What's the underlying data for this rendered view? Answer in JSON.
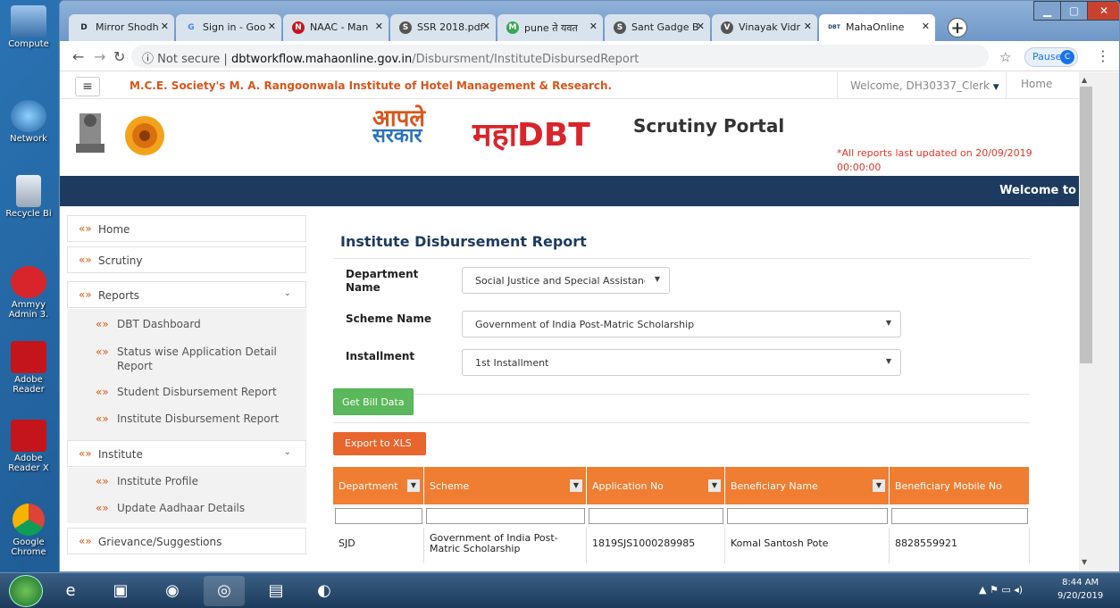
{
  "desktop": {
    "icons": [
      {
        "label": "Compute",
        "name": "computer-icon"
      },
      {
        "label": "Network",
        "name": "network-icon"
      },
      {
        "label": "Recycle Bi",
        "name": "recycle-bin-icon"
      },
      {
        "label": "Ammyy Admin 3.",
        "name": "ammyy-admin-icon"
      },
      {
        "label": "Adobe Reader",
        "name": "adobe-reader-icon"
      },
      {
        "label": "Adobe Reader X",
        "name": "adobe-reader-x-icon"
      },
      {
        "label": "Google Chrome",
        "name": "google-chrome-icon"
      }
    ]
  },
  "browser": {
    "tabs": [
      {
        "label": "Mirror Shodh",
        "icon": "D"
      },
      {
        "label": "Sign in - Goo",
        "icon": "G"
      },
      {
        "label": "NAAC - Man",
        "icon": "N"
      },
      {
        "label": "SSR 2018.pdf",
        "icon": "S"
      },
      {
        "label": "pune ते यवत",
        "icon": "M"
      },
      {
        "label": "Sant Gadge B",
        "icon": "S"
      },
      {
        "label": "Vinayak Vidr",
        "icon": "V"
      },
      {
        "label": "MahaOnline",
        "icon": "DBT"
      }
    ],
    "url_prefix": "Not secure",
    "url_domain": "dbtworkflow.mahaonline.gov.in",
    "url_path": "/Disbursment/InstituteDisbursedReport",
    "paused_label": "Paused",
    "profile_initial": "C"
  },
  "page": {
    "institute_name": "M.C.E. Society's M. A. Rangoonwala Institute of Hotel Management & Research.",
    "welcome_user": "Welcome, DH30337_Clerk",
    "home_link": "Home",
    "logo_line1": "आपले",
    "logo_line2": "सरकार",
    "maha_logo": "महाDBT",
    "portal_title": "Scrutiny Portal",
    "last_updated": "*All reports last updated on 20/09/2019 00:00:00",
    "marquee": "Welcome to"
  },
  "sidebar": {
    "home": "Home",
    "scrutiny": "Scrutiny",
    "reports": "Reports",
    "reports_items": [
      "DBT Dashboard",
      "Status wise Application Detail Report",
      "Student Disbursement Report",
      "Institute Disbursement Report"
    ],
    "institute": "Institute",
    "institute_items": [
      "Institute Profile",
      "Update Aadhaar Details"
    ],
    "grievance": "Grievance/Suggestions"
  },
  "report": {
    "title": "Institute Disbursement Report",
    "department_label": "Department Name",
    "department_value": "Social Justice and Special Assistance",
    "scheme_label": "Scheme Name",
    "scheme_value": "Government of India Post-Matric Scholarship",
    "installment_label": "Installment",
    "installment_value": "1st Installment",
    "get_bill_button": "Get Bill Data",
    "export_button": "Export to XLS",
    "columns": [
      "Department",
      "Scheme",
      "Application No",
      "Beneficiary Name",
      "Beneficiary Mobile No"
    ],
    "rows": [
      [
        "SJD",
        "Government of India Post-Matric Scholarship",
        "1819SJS1000289985",
        "Komal Santosh Pote",
        "8828559921"
      ]
    ]
  },
  "taskbar": {
    "time": "8:44 AM",
    "date": "9/20/2019"
  },
  "colors": {
    "accent_orange": "#ef7d32",
    "navy": "#1e3a5f",
    "green": "#5cb85c"
  }
}
